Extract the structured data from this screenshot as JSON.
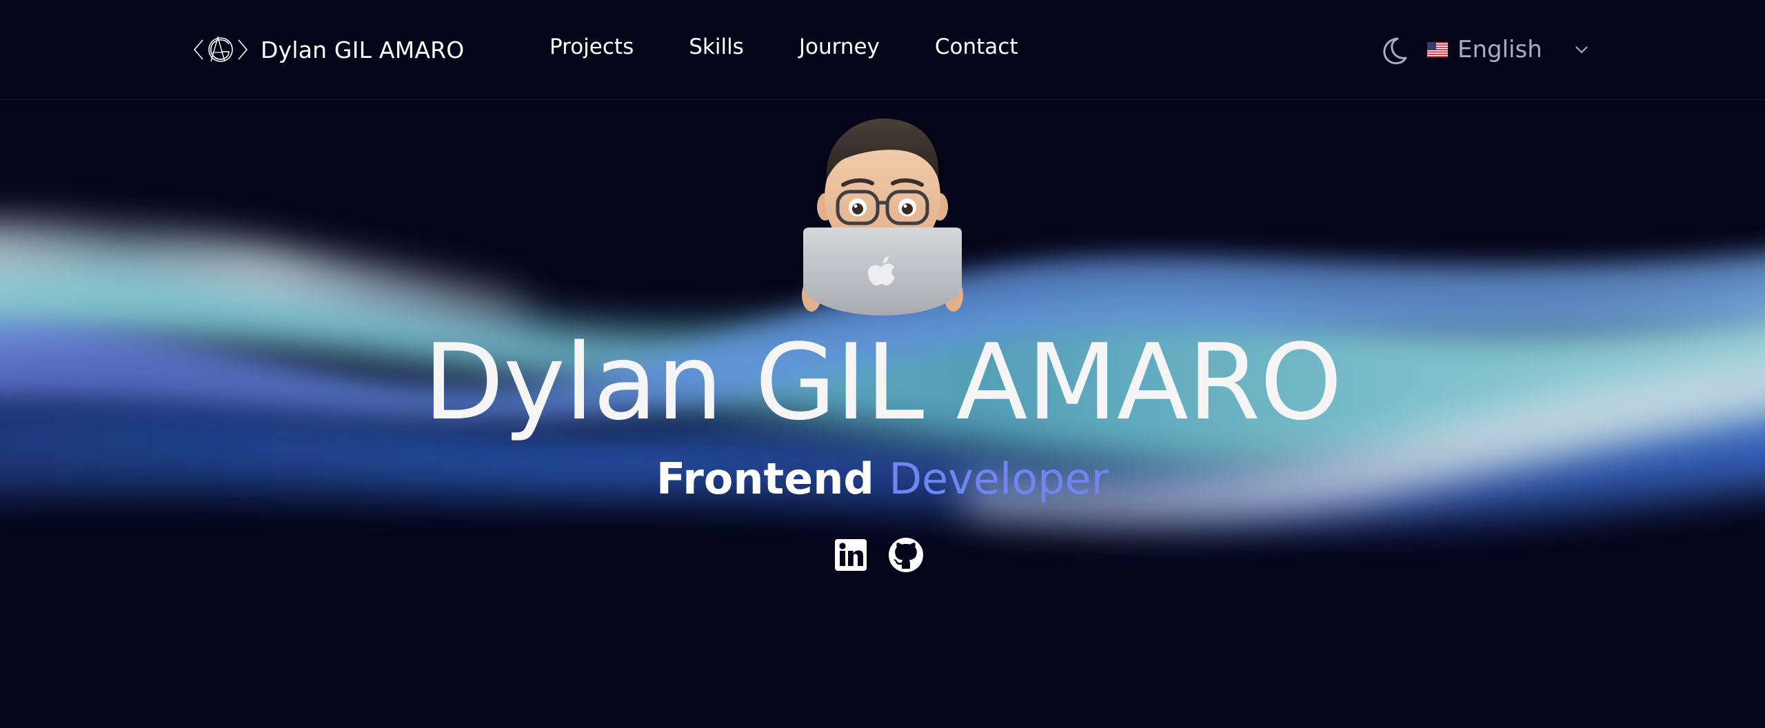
{
  "header": {
    "brand_name": "Dylan GIL AMARO",
    "logo_icon": "dga-monogram-icon",
    "nav": [
      {
        "label": "Projects"
      },
      {
        "label": "Skills"
      },
      {
        "label": "Journey"
      },
      {
        "label": "Contact"
      }
    ],
    "theme_icon": "moon-icon",
    "language": {
      "flag_icon": "us-flag-icon",
      "selected": "English",
      "chevron_icon": "chevron-down-icon"
    }
  },
  "hero": {
    "avatar_icon": "memoji-avatar-with-laptop",
    "title": "Dylan GIL AMARO",
    "subtitle_part1": "Frontend",
    "subtitle_part2": "Developer",
    "socials": [
      {
        "icon": "linkedin-icon"
      },
      {
        "icon": "github-icon"
      }
    ]
  },
  "colors": {
    "background": "#05051a",
    "accent": "#6f86f0",
    "text": "#ffffff",
    "muted": "#a8acc4"
  }
}
